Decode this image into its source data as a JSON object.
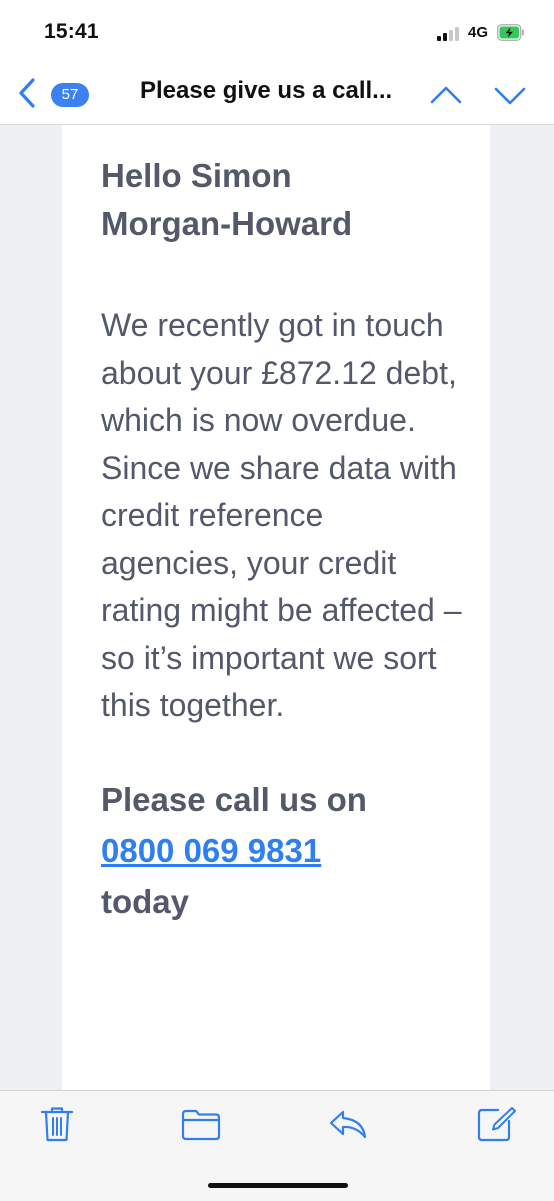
{
  "status_bar": {
    "time": "15:41",
    "network": "4G",
    "signal_bars_filled": 2,
    "signal_bars_total": 4,
    "battery_state": "charging"
  },
  "nav": {
    "back_icon": "chevron-left-icon",
    "unread_count": "57",
    "title": "Please give us a call...",
    "prev_icon": "chevron-up-icon",
    "next_icon": "chevron-down-icon"
  },
  "email": {
    "greeting": "Hello Simon Morgan-Howard",
    "body": "We recently got in touch about your £872.12 debt, which is now overdue. Since we share data with credit reference agencies, your credit rating might be affected – so it’s important we sort this together.",
    "cta_prefix": "Please call us on",
    "phone": "0800 069 9831",
    "cta_suffix": "today"
  },
  "toolbar": {
    "items": [
      "trash-icon",
      "folder-icon",
      "reply-icon",
      "compose-icon"
    ]
  },
  "colors": {
    "accent": "#2f7ff0",
    "badge": "#3b82f0",
    "body_text": "#53596a",
    "content_bg": "#eef0f3"
  }
}
